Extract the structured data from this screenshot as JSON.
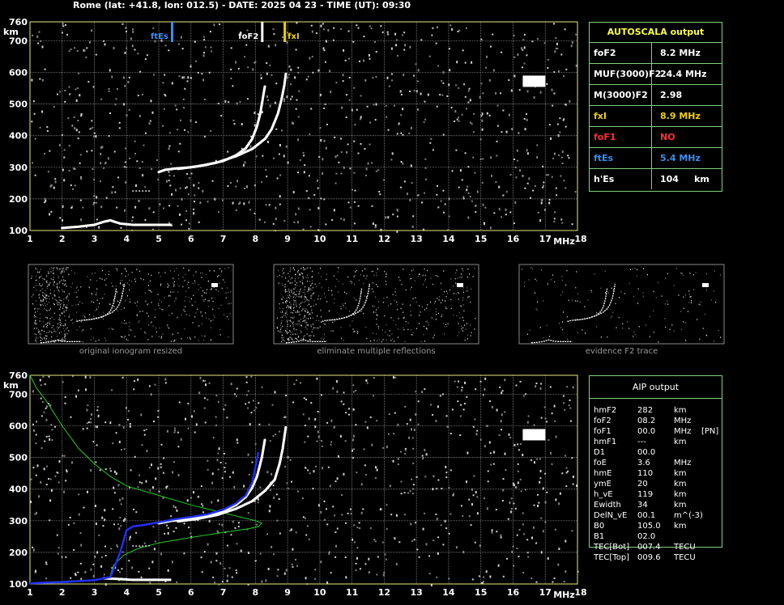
{
  "header": {
    "title": "Rome (lat: +41.8, lon: 012.5) - DATE: 2025 04 23 - TIME (UT): 09:30"
  },
  "colors": {
    "grid": "#9a9a9a",
    "axis": "#e8e880",
    "trace": "#ffffff",
    "ftEs": "#3a8ef0",
    "fxI": "#f0d000",
    "foF1": "#ff3030",
    "table_border": "#7fd07f",
    "table_title": "#ffff40",
    "profile": "#22cc22",
    "aip_trace": "#2030ff"
  },
  "chart_data": [
    {
      "type": "scatter",
      "name": "autoscala-ionogram",
      "xlabel": "MHz",
      "ylabel": "km",
      "xlim": [
        1,
        18
      ],
      "ylim": [
        100,
        760
      ],
      "x_ticks": [
        1,
        2,
        3,
        4,
        5,
        6,
        7,
        8,
        9,
        10,
        11,
        12,
        13,
        14,
        15,
        16,
        17,
        18
      ],
      "y_ticks": [
        100,
        200,
        300,
        400,
        500,
        600,
        700,
        760
      ],
      "grid": true,
      "markers": [
        {
          "label": "ftEs",
          "x": 5.4,
          "color": "#3a8ef0"
        },
        {
          "label": "foF2",
          "x": 8.2,
          "color": "#ffffff"
        },
        {
          "label": "fxI",
          "x": 8.9,
          "color": "#f0d000"
        }
      ],
      "traces": {
        "o_trace": [
          [
            5.0,
            285
          ],
          [
            5.2,
            292
          ],
          [
            5.6,
            297
          ],
          [
            6.0,
            300
          ],
          [
            6.5,
            308
          ],
          [
            7.0,
            320
          ],
          [
            7.4,
            338
          ],
          [
            7.7,
            360
          ],
          [
            7.9,
            390
          ],
          [
            8.05,
            430
          ],
          [
            8.15,
            470
          ],
          [
            8.2,
            500
          ],
          [
            8.3,
            560
          ]
        ],
        "x_trace": [
          [
            5.6,
            295
          ],
          [
            6.2,
            303
          ],
          [
            6.8,
            315
          ],
          [
            7.4,
            335
          ],
          [
            7.9,
            358
          ],
          [
            8.3,
            390
          ],
          [
            8.5,
            420
          ],
          [
            8.7,
            470
          ],
          [
            8.8,
            510
          ],
          [
            8.9,
            560
          ],
          [
            8.95,
            600
          ]
        ],
        "es_trace": [
          [
            2.0,
            108
          ],
          [
            2.5,
            112
          ],
          [
            3.0,
            118
          ],
          [
            3.3,
            128
          ],
          [
            3.5,
            132
          ],
          [
            3.8,
            122
          ],
          [
            4.2,
            118
          ],
          [
            4.6,
            118
          ],
          [
            5.4,
            118
          ]
        ],
        "es_second": [
          [
            4.2,
            225
          ],
          [
            4.5,
            225
          ],
          [
            4.8,
            225
          ]
        ]
      }
    },
    {
      "type": "scatter",
      "name": "aip-ionogram",
      "xlabel": "MHz",
      "ylabel": "km",
      "xlim": [
        1,
        18
      ],
      "ylim": [
        100,
        760
      ],
      "x_ticks": [
        1,
        2,
        3,
        4,
        5,
        6,
        7,
        8,
        9,
        10,
        11,
        12,
        13,
        14,
        15,
        16,
        17,
        18
      ],
      "y_ticks": [
        100,
        200,
        300,
        400,
        500,
        600,
        700,
        760
      ],
      "grid": true,
      "traces": {
        "o_trace": [
          [
            5.0,
            292
          ],
          [
            5.4,
            300
          ],
          [
            6.0,
            305
          ],
          [
            6.5,
            315
          ],
          [
            7.0,
            330
          ],
          [
            7.4,
            350
          ],
          [
            7.7,
            375
          ],
          [
            7.9,
            405
          ],
          [
            8.05,
            440
          ],
          [
            8.2,
            500
          ],
          [
            8.3,
            560
          ]
        ],
        "x_trace": [
          [
            5.6,
            298
          ],
          [
            6.2,
            306
          ],
          [
            6.8,
            318
          ],
          [
            7.4,
            338
          ],
          [
            7.9,
            362
          ],
          [
            8.3,
            395
          ],
          [
            8.6,
            430
          ],
          [
            8.75,
            480
          ],
          [
            8.85,
            530
          ],
          [
            8.95,
            600
          ]
        ],
        "es_trace": [
          [
            3.3,
            118
          ],
          [
            3.7,
            116
          ],
          [
            4.2,
            113
          ],
          [
            4.6,
            113
          ],
          [
            5.4,
            113
          ]
        ],
        "es_second": [
          [
            4.2,
            220
          ],
          [
            4.5,
            220
          ],
          [
            4.8,
            222
          ]
        ],
        "aip_fit": [
          [
            1.0,
            102
          ],
          [
            2.0,
            106
          ],
          [
            3.0,
            112
          ],
          [
            3.5,
            122
          ],
          [
            3.8,
            200
          ],
          [
            4.0,
            270
          ],
          [
            4.2,
            282
          ],
          [
            4.5,
            286
          ],
          [
            5.0,
            295
          ],
          [
            5.5,
            305
          ],
          [
            6.0,
            312
          ],
          [
            6.5,
            320
          ],
          [
            7.0,
            335
          ],
          [
            7.4,
            355
          ],
          [
            7.7,
            380
          ],
          [
            7.9,
            420
          ],
          [
            8.0,
            470
          ],
          [
            8.1,
            520
          ]
        ],
        "density_profile": [
          [
            1.0,
            760
          ],
          [
            1.2,
            720
          ],
          [
            1.5,
            680
          ],
          [
            2.0,
            600
          ],
          [
            2.5,
            530
          ],
          [
            3.0,
            480
          ],
          [
            3.5,
            440
          ],
          [
            4.0,
            410
          ],
          [
            5.0,
            380
          ],
          [
            6.0,
            350
          ],
          [
            7.0,
            325
          ],
          [
            7.6,
            310
          ],
          [
            8.0,
            300
          ],
          [
            8.2,
            293
          ],
          [
            8.1,
            282
          ],
          [
            7.8,
            275
          ],
          [
            7.0,
            263
          ],
          [
            6.0,
            247
          ],
          [
            5.0,
            230
          ],
          [
            4.3,
            210
          ],
          [
            3.9,
            190
          ],
          [
            3.6,
            160
          ],
          [
            3.5,
            130
          ],
          [
            3.5,
            118
          ],
          [
            3.0,
            113
          ],
          [
            2.0,
            108
          ],
          [
            1.0,
            103
          ]
        ]
      }
    }
  ],
  "axes": {
    "x_tick_labels": [
      "1",
      "2",
      "3",
      "4",
      "5",
      "6",
      "7",
      "8",
      "9",
      "10",
      "11",
      "12",
      "13",
      "14",
      "15",
      "16",
      "17",
      "18"
    ],
    "y_tick_labels": [
      "100",
      "200",
      "300",
      "400",
      "500",
      "600",
      "700",
      "760"
    ],
    "xlabel": "MHz",
    "ylabel": "km"
  },
  "top_chart": {
    "marker_labels": {
      "ftEs": "ftEs",
      "foF2": "foF2",
      "fxI": "fxI"
    }
  },
  "autoscala": {
    "title": "AUTOSCALA output",
    "rows": [
      {
        "label": "foF2",
        "value": "8.2 MHz",
        "color": "#ffffff"
      },
      {
        "label": "MUF(3000)F2",
        "value": "24.4 MHz",
        "color": "#ffffff"
      },
      {
        "label": "M(3000)F2",
        "value": "2.98",
        "color": "#ffffff"
      },
      {
        "label": "fxI",
        "value": "8.9 MHz",
        "color": "#f0d000"
      },
      {
        "label": "foF1",
        "value": "NO",
        "color": "#ff3030"
      },
      {
        "label": "ftEs",
        "value": "5.4 MHz",
        "color": "#3a8ef0"
      },
      {
        "label": "h'Es",
        "value": "104     km",
        "color": "#ffffff"
      }
    ]
  },
  "thumbnails": [
    {
      "caption": "original ionogram resized"
    },
    {
      "caption": "eliminate multiple reflections"
    },
    {
      "caption": "evidence F2 trace"
    }
  ],
  "aip": {
    "title": "AIP output",
    "rows": [
      {
        "name": "hmF2",
        "value": "282",
        "unit": "km",
        "extra": ""
      },
      {
        "name": "foF2",
        "value": "08.2",
        "unit": "MHz",
        "extra": ""
      },
      {
        "name": "foF1",
        "value": "00.0",
        "unit": "MHz",
        "extra": "[PN]"
      },
      {
        "name": "hmF1",
        "value": "---",
        "unit": "km",
        "extra": ""
      },
      {
        "name": "D1",
        "value": "00.0",
        "unit": "",
        "extra": ""
      },
      {
        "name": "foE",
        "value": "3.6",
        "unit": "MHz",
        "extra": ""
      },
      {
        "name": "hmE",
        "value": "110",
        "unit": "km",
        "extra": ""
      },
      {
        "name": "ymE",
        "value": "20",
        "unit": "km",
        "extra": ""
      },
      {
        "name": "h_vE",
        "value": "119",
        "unit": "km",
        "extra": ""
      },
      {
        "name": "Ewidth",
        "value": "34",
        "unit": "km",
        "extra": ""
      },
      {
        "name": "DelN_vE",
        "value": "00.1",
        "unit": "m^(-3)",
        "extra": ""
      },
      {
        "name": "B0",
        "value": "105.0",
        "unit": "km",
        "extra": ""
      },
      {
        "name": "B1",
        "value": "02.0",
        "unit": "",
        "extra": ""
      },
      {
        "name": "TEC[Bot]",
        "value": "007.4",
        "unit": "TECU",
        "extra": ""
      },
      {
        "name": "TEC[Top]",
        "value": "009.6",
        "unit": "TECU",
        "extra": ""
      }
    ]
  }
}
